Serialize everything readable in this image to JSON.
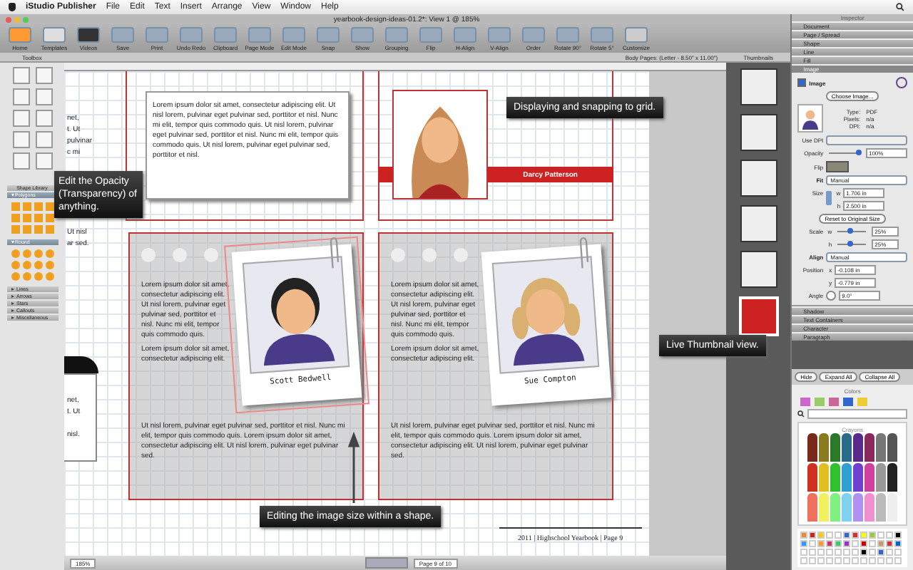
{
  "menu_bar": {
    "app": "iStudio Publisher",
    "items": [
      "File",
      "Edit",
      "Text",
      "Insert",
      "Arrange",
      "View",
      "Window",
      "Help"
    ]
  },
  "window": {
    "title": "yearbook-design-ideas-01.2*: View 1 @ 185%"
  },
  "toolbar": [
    {
      "label": "Home"
    },
    {
      "label": "Templates"
    },
    {
      "label": "Videos"
    },
    {
      "label": "Save"
    },
    {
      "label": "Print"
    },
    {
      "label": "Undo Redo"
    },
    {
      "label": "Clipboard"
    },
    {
      "label": "Page Mode"
    },
    {
      "label": "Edit Mode"
    },
    {
      "label": "Snap"
    },
    {
      "label": "Show"
    },
    {
      "label": "Grouping"
    },
    {
      "label": "Flip"
    },
    {
      "label": "H-Align"
    },
    {
      "label": "V-Align"
    },
    {
      "label": "Order"
    },
    {
      "label": "Rotate 90°"
    },
    {
      "label": "Rotate 5°"
    },
    {
      "label": "Customize"
    }
  ],
  "toolbox": {
    "title": "Toolbox",
    "library_title": "Shape Library",
    "sections": [
      {
        "label": "Polygons",
        "expanded": true
      },
      {
        "label": "Round",
        "expanded": true
      },
      {
        "label": "Lines",
        "expanded": false
      },
      {
        "label": "Arrows",
        "expanded": false
      },
      {
        "label": "Stars",
        "expanded": false
      },
      {
        "label": "Callouts",
        "expanded": false
      },
      {
        "label": "Miscellaneous",
        "expanded": false
      }
    ]
  },
  "page_info": "Body Pages: (Letter - 8.50\" x 11.00\")",
  "thumbnails": {
    "title": "Thumbnails",
    "pages": [
      {
        "selected": false
      },
      {
        "selected": false
      },
      {
        "selected": false
      },
      {
        "selected": false
      },
      {
        "selected": false
      },
      {
        "selected": true
      }
    ]
  },
  "canvas": {
    "left_page_fragments": [
      {
        "text": "net,"
      },
      {
        "text": "t. Ut"
      },
      {
        "text": "pulvinar"
      },
      {
        "text": "c mi"
      },
      {
        "text": "Ut nisl"
      },
      {
        "text": "ar sed."
      },
      {
        "text": "net,"
      },
      {
        "text": "t. Ut"
      },
      {
        "text": "nisl."
      }
    ],
    "top_text": "Lorem ipsum dolor sit amet, consectetur adipiscing elit. Ut nisl lorem, pulvinar eget pulvinar sed, porttitor et nisl. Nunc mi elit, tempor quis commodo quis. Ut nisl lorem, pulvinar eget pulvinar sed, porttitor et nisl. Nunc mi elit, tempor quis commodo quis. Ut nisl lorem, pulvinar eget pulvinar sed, porttitor et nisl.",
    "top_photo_caption": "Darcy Patterson",
    "cards": [
      {
        "name": "Scott Bedwell",
        "kind": "short_hair",
        "selected": true,
        "paragraphs": [
          "Lorem ipsum dolor sit amet, consectetur adipiscing elit. Ut nisl lorem, pulvinar eget pulvinar sed, porttitor et nisl. Nunc mi elit, tempor quis commodo quis.",
          "Lorem ipsum dolor sit amet, consectetur adipiscing elit."
        ],
        "body": "Ut nisl lorem, pulvinar eget pulvinar sed, porttitor et nisl. Nunc mi elit, tempor quis commodo quis. Lorem ipsum dolor sit amet, consectetur adipiscing elit. Ut nisl lorem, pulvinar eget pulvinar sed."
      },
      {
        "name": "Sue Compton",
        "kind": "pigtails",
        "selected": false,
        "paragraphs": [
          "Lorem ipsum dolor sit amet, consectetur adipiscing elit. Ut nisl lorem, pulvinar eget pulvinar sed, porttitor et nisl. Nunc mi elit, tempor quis commodo quis.",
          "Lorem ipsum dolor sit amet, consectetur adipiscing elit."
        ],
        "body": "Ut nisl lorem, pulvinar eget pulvinar sed, porttitor et nisl. Nunc mi elit, tempor quis commodo quis. Lorem ipsum dolor sit amet, consectetur adipiscing elit. Ut nisl lorem, pulvinar eget pulvinar sed."
      }
    ],
    "footer": "2011  |  Highschool Yearbook  |  Page 9"
  },
  "callouts": {
    "opacity": "Edit the Opacity (Transparency) of anything.",
    "grid": "Displaying and snapping to grid.",
    "thumbnail": "Live Thumbnail view.",
    "image_size": "Editing the image size within a shape."
  },
  "status_bar": {
    "zoom": "185%",
    "page": "Page 9 of 10"
  },
  "inspector": {
    "title": "Inspector",
    "sections_top": [
      "Document",
      "Page / Spread",
      "Shape",
      "Line",
      "Fill"
    ],
    "image_section": "Image",
    "image_checked": true,
    "image_label": "Image",
    "choose": "Choose Image...",
    "info": [
      {
        "label": "Type:",
        "value": "PDF"
      },
      {
        "label": "Pixels:",
        "value": "n/a"
      },
      {
        "label": "DPI:",
        "value": "n/a"
      }
    ],
    "use_dpi": "Use DPI",
    "opacity_label": "Opacity",
    "opacity": {
      "level": 0.95
    },
    "opacity_value": "100%",
    "flip_label": "Flip",
    "fit_label": "Fit",
    "fit": "Manual",
    "size_label": "Size",
    "w_label": "w",
    "w": "1.706 in",
    "h_label": "h",
    "h": "2.500 in",
    "reset": "Reset to Original Size",
    "scale_label": "Scale",
    "scale_w_label": "w",
    "scale_h_label": "h",
    "scale_w": {
      "level": 0.45
    },
    "scale_w_value": "25%",
    "scale_h": {
      "level": 0.45
    },
    "scale_h_value": "25%",
    "align_label": "Align",
    "align": "Manual",
    "position_label": "Position",
    "x_label": "x",
    "x": "-0.108 in",
    "y_label": "y",
    "y": "-0.779 in",
    "angle_label": "Angle",
    "angle": "9.0°",
    "sections_bottom": [
      "Shadow",
      "Text Containers",
      "Character",
      "Paragraph"
    ],
    "buttons": [
      "Hide",
      "Expand All",
      "Collapse All"
    ]
  },
  "colors": {
    "title": "Colors",
    "palette": "Crayons"
  }
}
